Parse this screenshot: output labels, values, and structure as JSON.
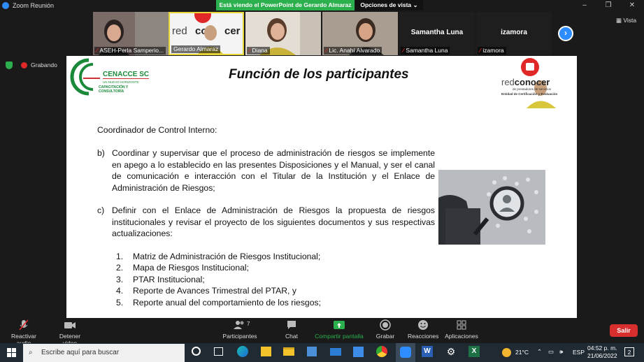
{
  "window": {
    "title": "Zoom Reunión",
    "minimize": "–",
    "maximize": "❐",
    "close": "✕"
  },
  "share_banner": "Está viendo el PowerPoint de Gerardo Almaraz",
  "view_options": "Opciones de vista ⌄",
  "view_label": "Vista",
  "recording_label": "Grabando",
  "participants": [
    {
      "name": "ASEH-Perla Samperio...",
      "muted": true
    },
    {
      "name": "Gerardo Almaraz",
      "muted": false
    },
    {
      "name": "Diana",
      "muted": true
    },
    {
      "name": "Lic. Anahí Alvarado",
      "muted": true
    },
    {
      "name": "Samantha Luna",
      "muted": true,
      "big": "Samantha Luna"
    },
    {
      "name": "izamora",
      "muted": true,
      "big": "izamora"
    }
  ],
  "slide": {
    "title": "Función de los participantes",
    "logo_left": {
      "brand": "CENACCE SC",
      "tag1": "UN NUEVO HORIZONTE",
      "tag2": "CAPACITACIÓN Y CONSULTORÍA"
    },
    "logo_right": {
      "brand_a": "red",
      "brand_b": "conocer",
      "sub1": "de prestadores de servicios",
      "sub2": "Entidad de Certificación y Evaluación"
    },
    "heading": "Coordinador de Control Interno:",
    "item_b_label": "b)",
    "item_b_text": "Coordinar y supervisar que el proceso de administración de riesgos se implemente en apego a lo establecido en las presentes Disposiciones y el Manual, y ser el canal de comunicación e interacción con el Titular de la Institución y el Enlace de Administración de Riesgos;",
    "item_c_label": "c)",
    "item_c_text": "Definir con el Enlace de Administración de Riesgos la propuesta de riesgos institucionales y revisar el proyecto de los siguientes documentos y sus respectivas actualizaciones:",
    "list": [
      {
        "n": "1.",
        "text": "Matriz de Administración de Riesgos Institucional;"
      },
      {
        "n": "2.",
        "text": "Mapa de Riesgos Institucional;"
      },
      {
        "n": "3.",
        "text": "PTAR Institucional;"
      },
      {
        "n": "4.",
        "text": "Reporte de Avances Trimestral del PTAR, y"
      },
      {
        "n": "5.",
        "text": "Reporte anual del comportamiento de los riesgos;"
      }
    ]
  },
  "toolbar": {
    "audio": "Reactivar audio",
    "video": "Detener video",
    "participants": "Participantes",
    "participants_count": "7",
    "chat": "Chat",
    "share": "Compartir pantalla",
    "record": "Grabar",
    "reactions": "Reacciones",
    "apps": "Aplicaciones",
    "leave": "Salir"
  },
  "taskbar": {
    "search_placeholder": "Escribe aquí para buscar",
    "temperature": "21°C",
    "language": "ESP",
    "time": "04:52 p. m.",
    "date": "21/06/2022",
    "notifications": "2"
  },
  "colors": {
    "share_green": "#2cb04e",
    "zoom_blue": "#2d8cff",
    "leave_red": "#d92e2e",
    "taskbar": "#1f2a33"
  }
}
